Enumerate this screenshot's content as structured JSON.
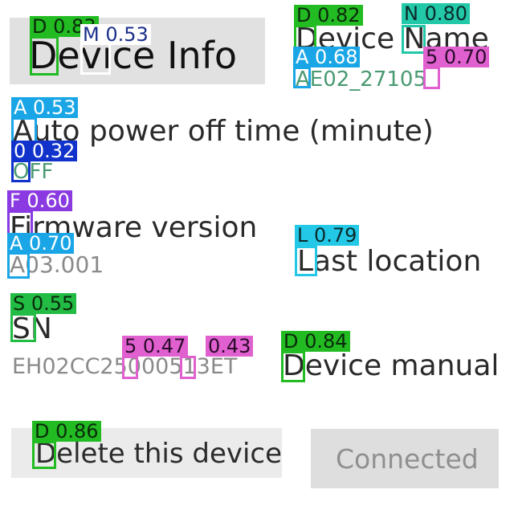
{
  "header": {
    "title": "Device Info"
  },
  "device": {
    "name_label": "Device Name",
    "name_value": "AE02_27105",
    "auto_off_label": "Auto power off time (minute)",
    "auto_off_value": "OFF",
    "firmware_label": "Firmware version",
    "firmware_value": "A03.001",
    "last_location_label": "Last location",
    "sn_label": "SN",
    "sn_value": "EH02CC25000513ET",
    "manual_label": "Device manual"
  },
  "actions": {
    "delete_label": "Delete this device",
    "status_label": "Connected"
  },
  "detections": [
    {
      "label": "D 0.83",
      "color": "#22bb22"
    },
    {
      "label": "M 0.53",
      "color": "#1a2f8a"
    },
    {
      "label": "D 0.82",
      "color": "#22bb22"
    },
    {
      "label": "N 0.80",
      "color": "#22c8a8"
    },
    {
      "label": "A 0.68",
      "color": "#1aa6e6"
    },
    {
      "label": "5 0.70",
      "color": "#e060d0"
    },
    {
      "label": "A 0.53",
      "color": "#1aa6e6"
    },
    {
      "label": "0 0.32",
      "color": "#1133cc"
    },
    {
      "label": "F 0.60",
      "color": "#8a3ae0"
    },
    {
      "label": "A 0.70",
      "color": "#1aa6e6"
    },
    {
      "label": "L 0.79",
      "color": "#22c8e6"
    },
    {
      "label": "S 0.55",
      "color": "#22bb44"
    },
    {
      "label": "5 0.47",
      "color": "#e060d0"
    },
    {
      "label": "0.43",
      "color": "#e060d0"
    },
    {
      "label": "D 0.84",
      "color": "#22bb22"
    },
    {
      "label": "D 0.86",
      "color": "#22bb22"
    }
  ]
}
